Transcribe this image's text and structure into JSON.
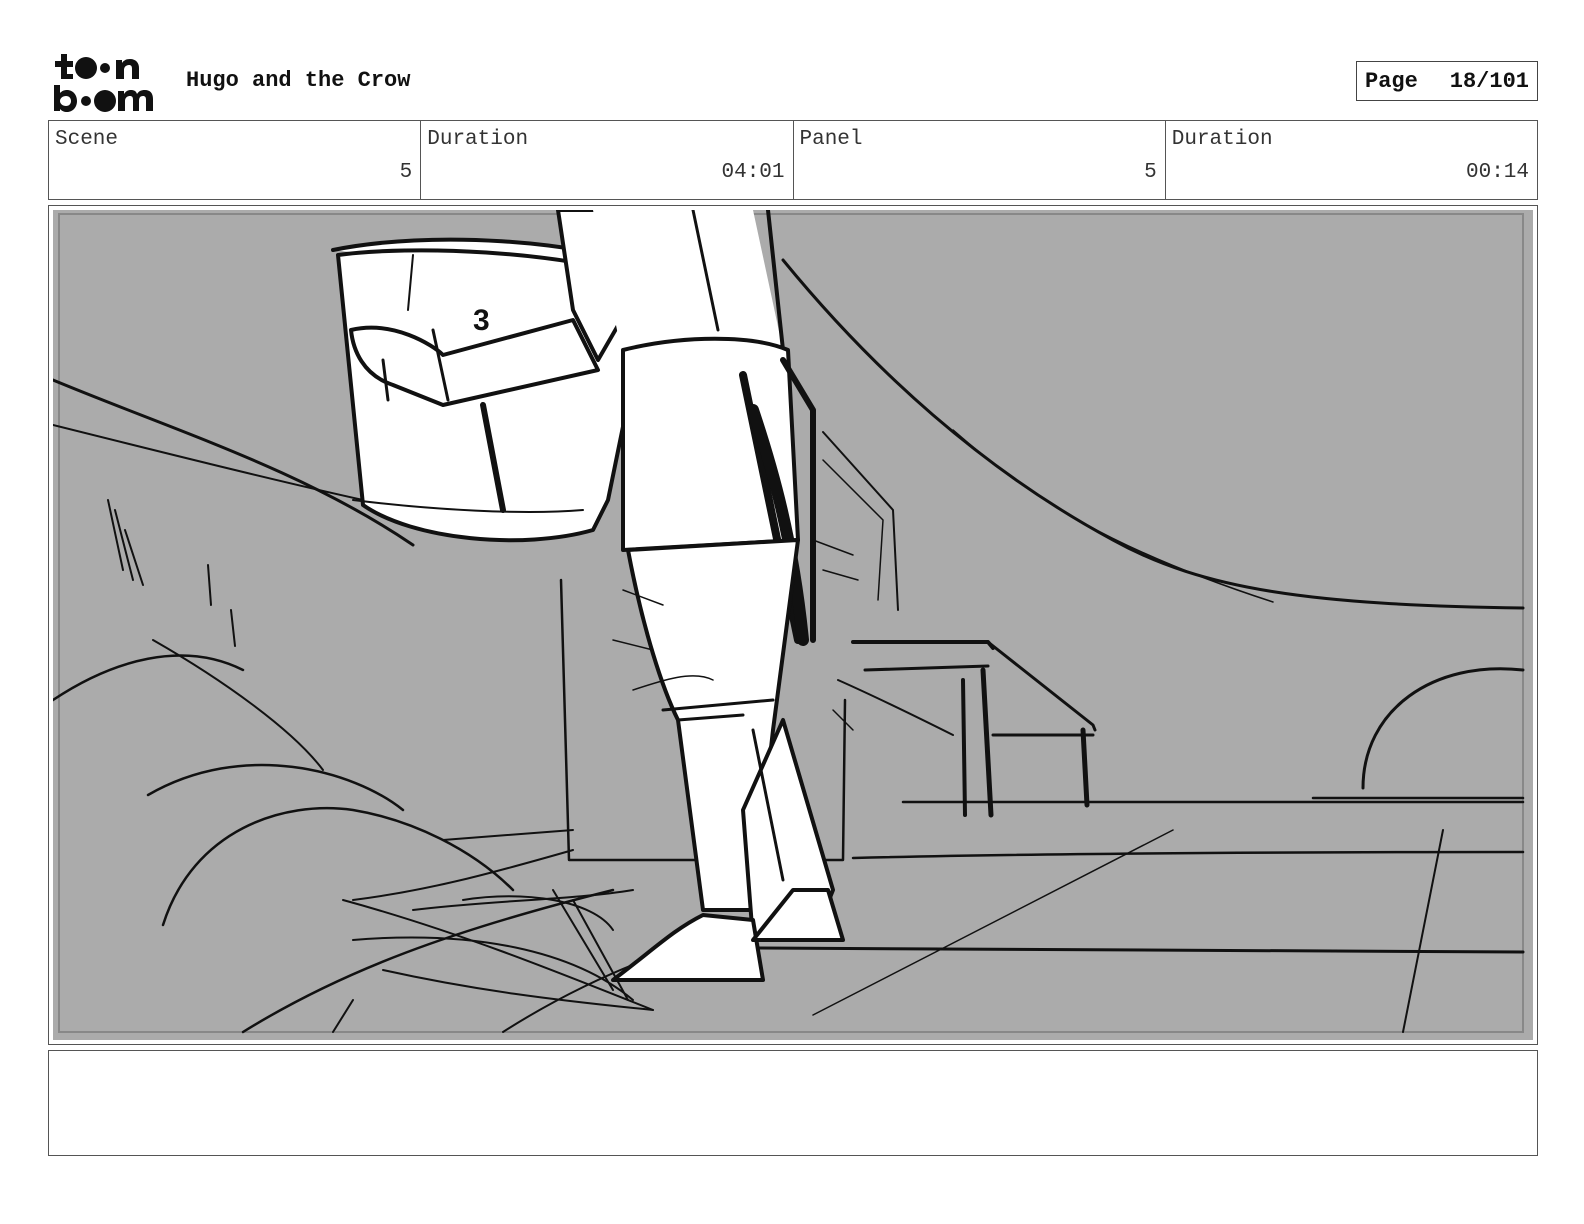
{
  "header": {
    "logo_text": "toon boom",
    "project_title": "Hugo and the Crow",
    "page_label": "Page",
    "page_value": "18/101"
  },
  "info": {
    "scene_label": "Scene",
    "scene_value": "5",
    "scene_duration_label": "Duration",
    "scene_duration_value": "04:01",
    "panel_label": "Panel",
    "panel_value": "5",
    "panel_duration_label": "Duration",
    "panel_duration_value": "00:14"
  },
  "panel_sketch": {
    "annotation": "3",
    "background_color": "#ababab"
  },
  "notes": {
    "text": ""
  }
}
